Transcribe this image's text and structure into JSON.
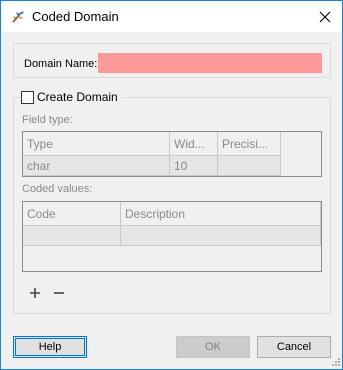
{
  "window": {
    "title": "Coded Domain",
    "app_icon": "fme-feather-icon",
    "close_icon": "close-icon"
  },
  "domain_name": {
    "label": "Domain Name:",
    "value": "",
    "highlight_color": "#ff9999"
  },
  "create_domain": {
    "label": "Create Domain",
    "checked": false
  },
  "field_type": {
    "label": "Field type:",
    "columns": [
      "Type",
      "Wid...",
      "Precisi..."
    ],
    "rows": [
      [
        "char",
        "10",
        ""
      ]
    ]
  },
  "coded_values": {
    "label": "Coded values:",
    "columns": [
      "Code",
      "Description"
    ],
    "rows": [
      [
        "",
        ""
      ]
    ],
    "add_icon": "plus-icon",
    "remove_icon": "minus-icon"
  },
  "buttons": {
    "help": "Help",
    "ok": "OK",
    "cancel": "Cancel"
  },
  "colors": {
    "accent": "#0078d7",
    "disabled_text": "#8a8a8a"
  }
}
